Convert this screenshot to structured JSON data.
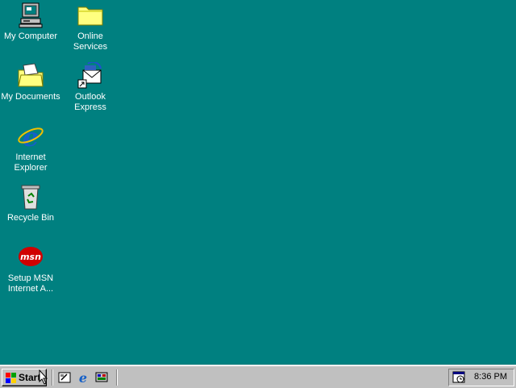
{
  "desktop": {
    "background": "#008080",
    "icons": [
      {
        "label": "My Computer",
        "icon": "my-computer-icon"
      },
      {
        "label": "Online\nServices",
        "icon": "folder-icon"
      },
      {
        "label": "My Documents",
        "icon": "my-documents-icon"
      },
      {
        "label": "Outlook\nExpress",
        "icon": "outlook-express-icon"
      },
      {
        "label": "Internet\nExplorer",
        "icon": "internet-explorer-icon"
      },
      {
        "label": "Recycle Bin",
        "icon": "recycle-bin-icon"
      },
      {
        "label": "Setup MSN\nInternet A...",
        "icon": "msn-icon"
      }
    ]
  },
  "taskbar": {
    "start_label": "Start",
    "quick_launch": [
      "show-desktop-icon",
      "internet-explorer-icon",
      "channels-icon"
    ],
    "clock": "8:36 PM",
    "tray_icon": "scheduler-icon"
  }
}
